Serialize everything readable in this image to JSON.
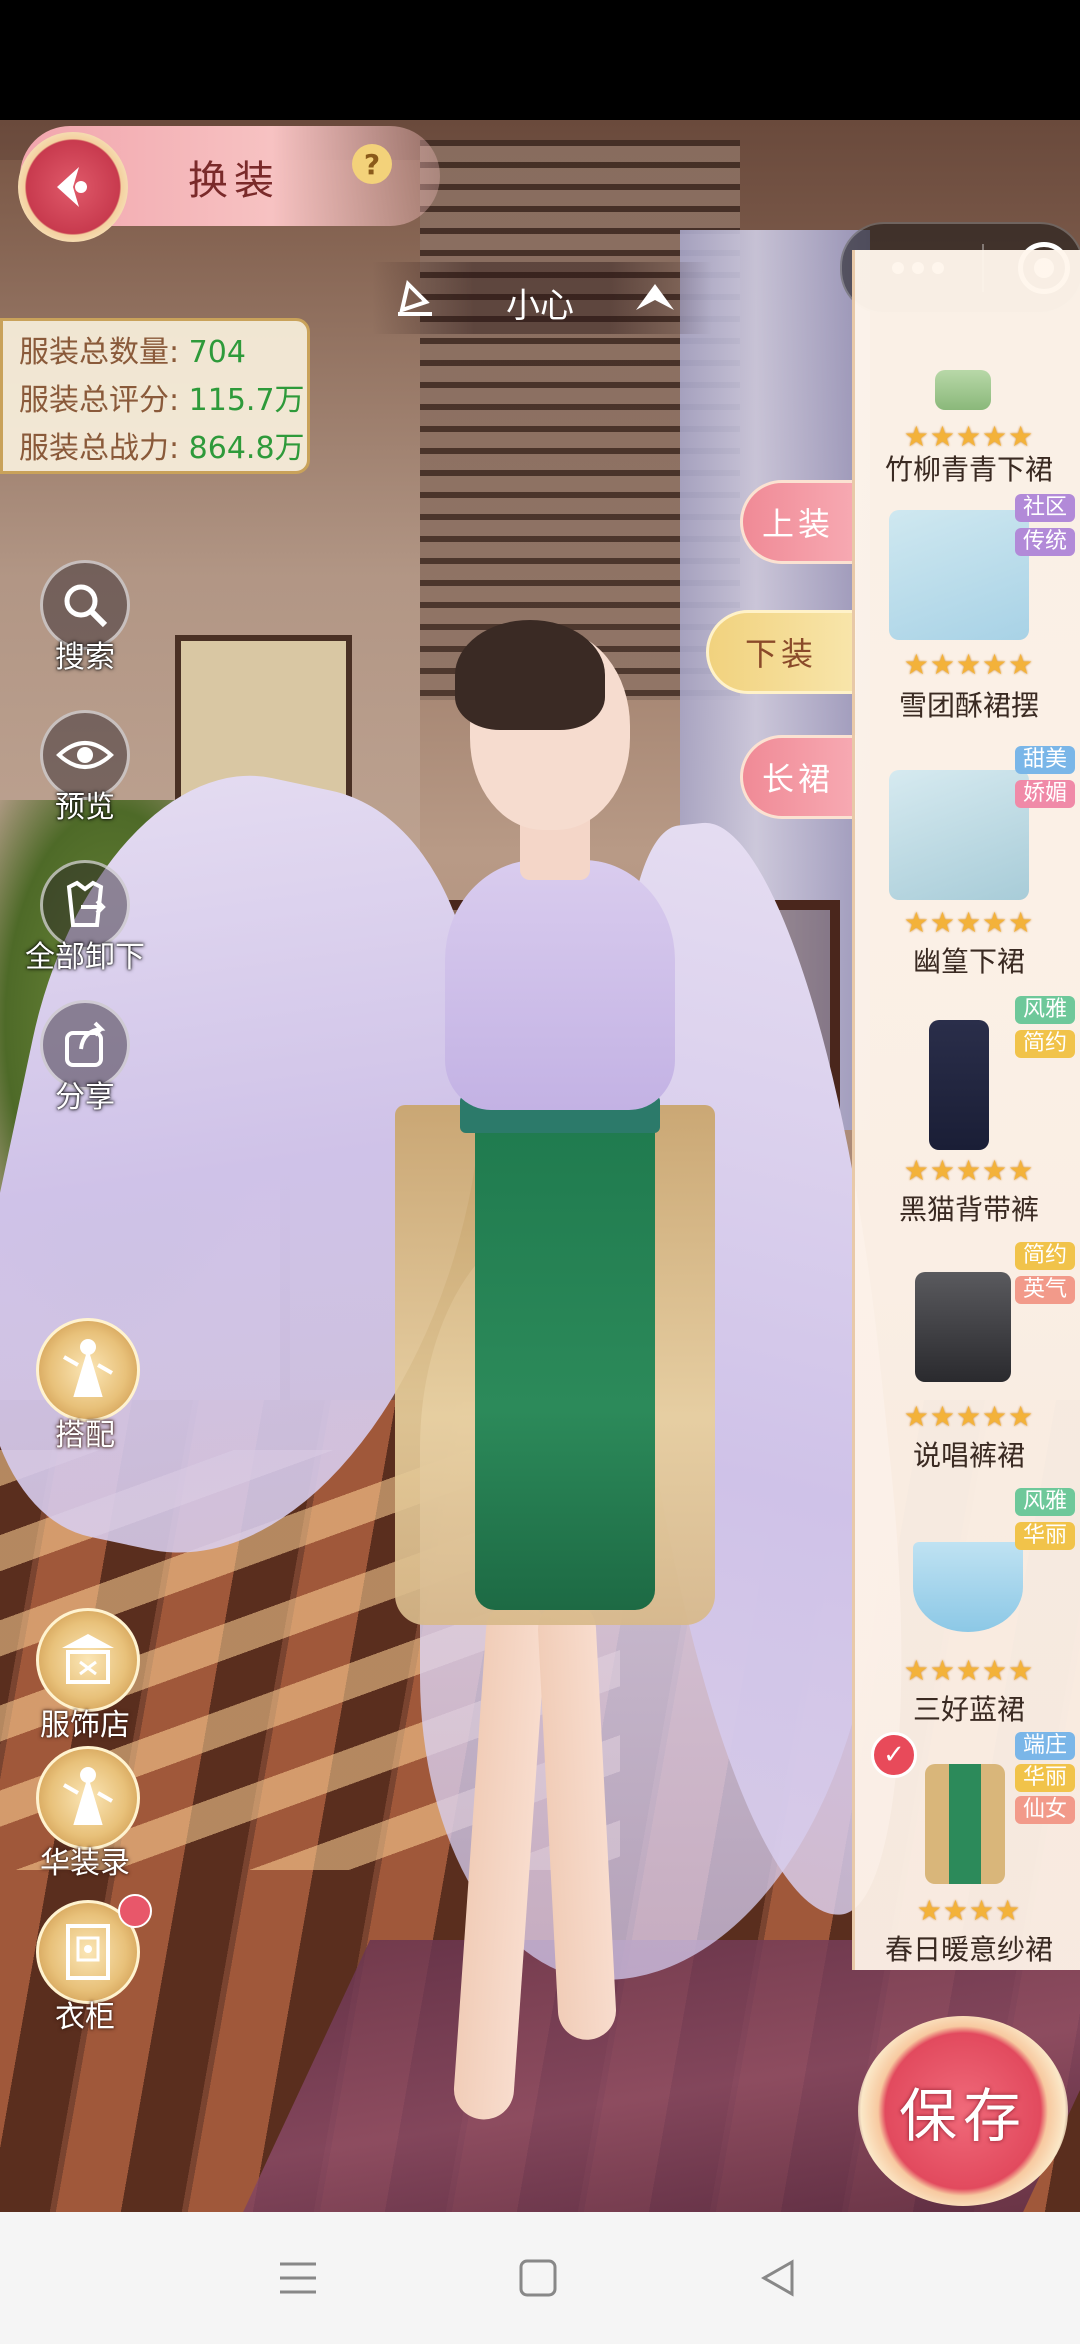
{
  "header": {
    "title": "换装",
    "help_icon": "question-icon",
    "back_icon": "back-emblem-icon"
  },
  "character": {
    "name": "小心"
  },
  "capsule": {
    "more_icon": "more-dots-icon",
    "close_icon": "close-target-icon"
  },
  "stats": [
    {
      "label": "服装总数量:",
      "value": "704"
    },
    {
      "label": "服装总评分:",
      "value": "115.7万"
    },
    {
      "label": "服装总战力:",
      "value": "864.8万"
    }
  ],
  "side_buttons": [
    {
      "label": "搜索",
      "icon": "search-icon"
    },
    {
      "label": "预览",
      "icon": "eye-icon"
    },
    {
      "label": "全部卸下",
      "icon": "undress-icon"
    },
    {
      "label": "分享",
      "icon": "share-icon"
    }
  ],
  "gold_buttons": [
    {
      "label": "搭配",
      "icon": "dancer-icon"
    },
    {
      "label": "服饰店",
      "icon": "shop-icon"
    },
    {
      "label": "华装录",
      "icon": "dancer-icon"
    },
    {
      "label": "衣柜",
      "icon": "wardrobe-icon",
      "badge": true
    }
  ],
  "categories": [
    {
      "label": "上装",
      "style": "pink"
    },
    {
      "label": "下装",
      "style": "gold"
    },
    {
      "label": "长裙",
      "style": "pink"
    }
  ],
  "items": [
    {
      "name": "竹柳青青下裙",
      "stars": "★★★★★",
      "tags": [],
      "colors": [
        "#b8d8a8",
        "#8ab87a"
      ]
    },
    {
      "name": "雪团酥裙摆",
      "stars": "★★★★★",
      "tags": [
        "社区",
        "传统"
      ],
      "colors": [
        "#cfe8f0",
        "#a8d2e6"
      ]
    },
    {
      "name": "幽篁下裙",
      "stars": "★★★★★",
      "tags": [
        "甜美",
        "娇媚"
      ],
      "colors": [
        "#d6eaf0",
        "#a8ccd8"
      ]
    },
    {
      "name": "黑猫背带裤",
      "stars": "★★★★★",
      "tags": [
        "风雅",
        "简约"
      ],
      "colors": [
        "#2a2e4a",
        "#1a1e36"
      ]
    },
    {
      "name": "说唱裤裙",
      "stars": "★★★★★",
      "tags": [
        "简约",
        "英气"
      ],
      "colors": [
        "#5a5a5e",
        "#2a2a2e"
      ]
    },
    {
      "name": "三好蓝裙",
      "stars": "★★★★★",
      "tags": [
        "风雅",
        "华丽"
      ],
      "colors": [
        "#bfe2f2",
        "#8cc8e6"
      ]
    },
    {
      "name": "春日暖意纱裙",
      "stars": "★★★★",
      "tags": [
        "端庄",
        "华丽",
        "仙女"
      ],
      "colors": [
        "#d9b67a",
        "#2c8a5a"
      ],
      "equipped": true
    }
  ],
  "save": {
    "label": "保存"
  },
  "colors": {
    "accent_pink": "#f08a96",
    "stat_green": "#2e9a3a",
    "gold": "#e8c17a"
  }
}
